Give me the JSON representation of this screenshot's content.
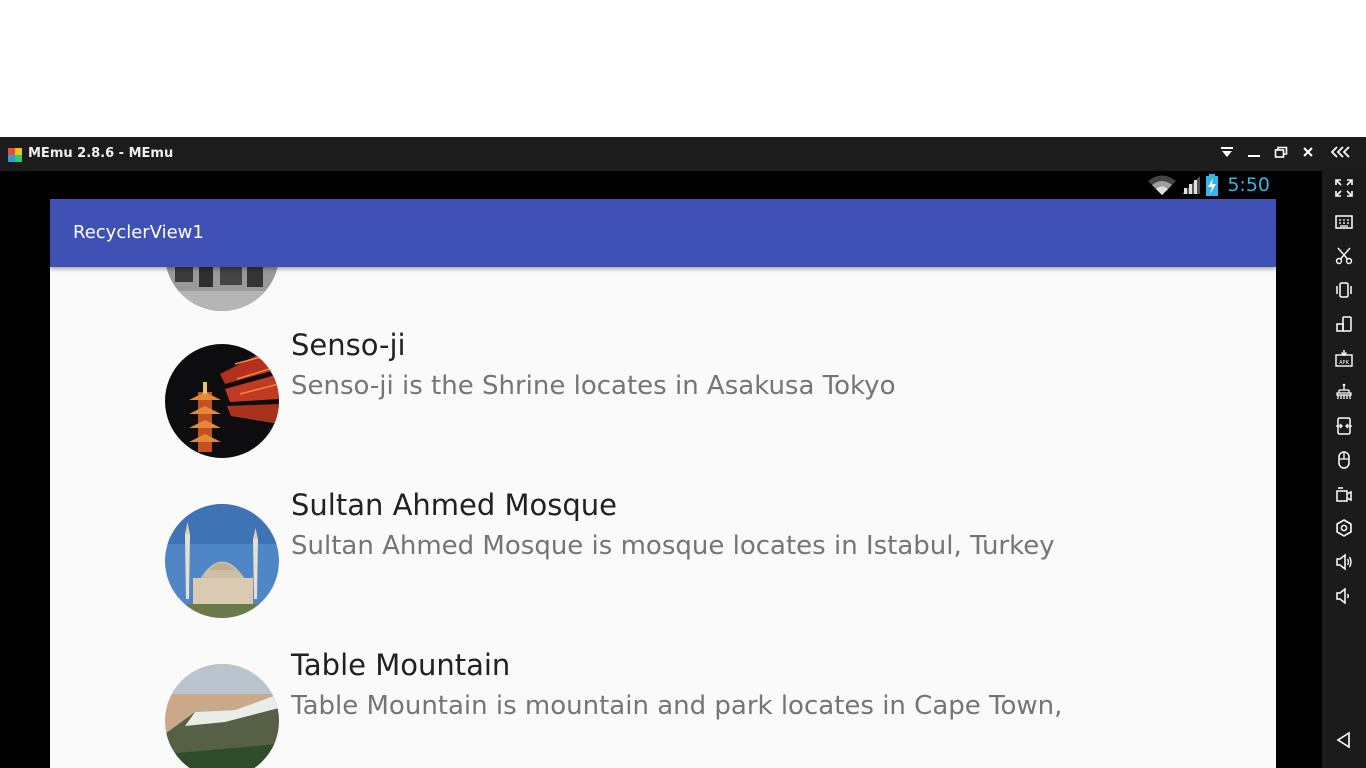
{
  "window": {
    "title": "MEmu 2.8.6 - MEmu"
  },
  "status_bar": {
    "time": "5:50"
  },
  "app_bar": {
    "title": "RecyclerView1"
  },
  "list": {
    "items": [
      {
        "title": "",
        "description": "",
        "image_icon": "city-photo"
      },
      {
        "title": "Senso-ji",
        "description": "Senso-ji is the Shrine locates in Asakusa Tokyo",
        "image_icon": "pagoda-photo"
      },
      {
        "title": "Sultan Ahmed Mosque",
        "description": "Sultan Ahmed Mosque is mosque locates in Istabul, Turkey",
        "image_icon": "mosque-photo"
      },
      {
        "title": "Table Mountain",
        "description": "Table Mountain is mountain and park locates in Cape Town,",
        "image_icon": "mountain-photo"
      }
    ]
  },
  "sidebar": {
    "tools": [
      "fullscreen-icon",
      "keyboard-icon",
      "screenshot-icon",
      "shake-icon",
      "rotate-icon",
      "apk-install-icon",
      "share-icon",
      "multi-instance-icon",
      "mouse-icon",
      "record-video-icon",
      "settings-icon",
      "volume-up-icon",
      "volume-down-icon",
      "back-icon"
    ]
  },
  "colors": {
    "app_bar": "#3f51b5",
    "status_time": "#33b5e5",
    "title_text": "#212121",
    "description_text": "#757575",
    "list_background": "#fafafa"
  }
}
